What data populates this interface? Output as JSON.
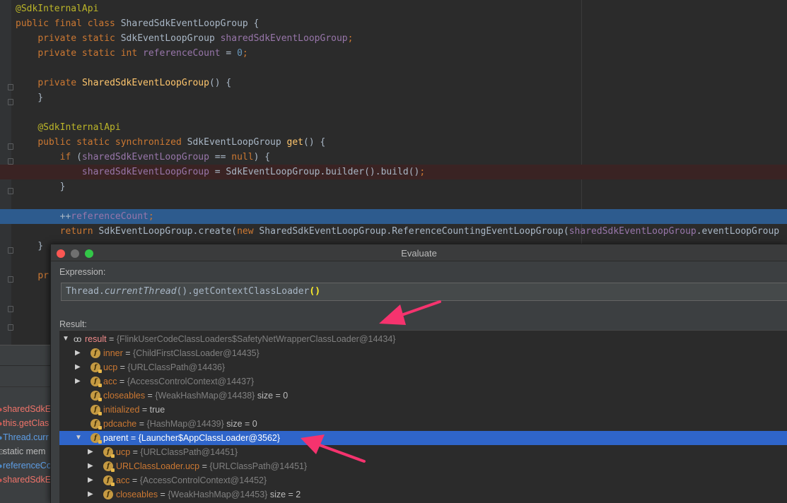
{
  "editor": {
    "lines": [
      {
        "type": "plain",
        "parts": [
          [
            "ann",
            "@SdkInternalApi"
          ]
        ]
      },
      {
        "type": "plain",
        "parts": [
          [
            "kw",
            "public final class "
          ],
          [
            "txt",
            "SharedSdkEventLoopGroup {"
          ]
        ]
      },
      {
        "type": "plain",
        "parts": [
          [
            "txt",
            "    "
          ],
          [
            "kw",
            "private static "
          ],
          [
            "txt",
            "SdkEventLoopGroup "
          ],
          [
            "fld",
            "sharedSdkEventLoopGroup"
          ],
          [
            "kw",
            ";"
          ]
        ]
      },
      {
        "type": "plain",
        "parts": [
          [
            "txt",
            "    "
          ],
          [
            "kw",
            "private static int "
          ],
          [
            "fld",
            "referenceCount"
          ],
          [
            "txt",
            " = "
          ],
          [
            "num",
            "0"
          ],
          [
            "kw",
            ";"
          ]
        ]
      },
      {
        "type": "plain",
        "parts": [
          [
            "txt",
            ""
          ]
        ]
      },
      {
        "type": "plain",
        "parts": [
          [
            "txt",
            "    "
          ],
          [
            "kw",
            "private "
          ],
          [
            "fn",
            "SharedSdkEventLoopGroup"
          ],
          [
            "txt",
            "() {"
          ]
        ]
      },
      {
        "type": "plain",
        "parts": [
          [
            "txt",
            "    }"
          ]
        ]
      },
      {
        "type": "plain",
        "parts": [
          [
            "txt",
            ""
          ]
        ]
      },
      {
        "type": "plain",
        "parts": [
          [
            "txt",
            "    "
          ],
          [
            "ann",
            "@SdkInternalApi"
          ]
        ]
      },
      {
        "type": "plain",
        "parts": [
          [
            "txt",
            "    "
          ],
          [
            "kw",
            "public static synchronized "
          ],
          [
            "txt",
            "SdkEventLoopGroup "
          ],
          [
            "fn",
            "get"
          ],
          [
            "txt",
            "() {"
          ]
        ]
      },
      {
        "type": "plain",
        "parts": [
          [
            "txt",
            "        "
          ],
          [
            "kw",
            "if "
          ],
          [
            "txt",
            "("
          ],
          [
            "fld",
            "sharedSdkEventLoopGroup"
          ],
          [
            "txt",
            " == "
          ],
          [
            "kw",
            "null"
          ],
          [
            "txt",
            ") {"
          ]
        ]
      },
      {
        "type": "breakpoint",
        "parts": [
          [
            "txt",
            "            "
          ],
          [
            "fld",
            "sharedSdkEventLoopGroup"
          ],
          [
            "txt",
            " = SdkEventLoopGroup."
          ],
          [
            "txt",
            "builder().build()"
          ],
          [
            "kw",
            ";"
          ]
        ]
      },
      {
        "type": "plain",
        "parts": [
          [
            "txt",
            "        }"
          ]
        ]
      },
      {
        "type": "plain",
        "parts": [
          [
            "txt",
            ""
          ]
        ]
      },
      {
        "type": "exec",
        "parts": [
          [
            "txt",
            "        ++"
          ],
          [
            "fld",
            "referenceCount"
          ],
          [
            "kw",
            ";"
          ]
        ]
      },
      {
        "type": "plain",
        "parts": [
          [
            "txt",
            "        "
          ],
          [
            "kw",
            "return "
          ],
          [
            "txt",
            "SdkEventLoopGroup."
          ],
          [
            "txt",
            "create("
          ],
          [
            "kw",
            "new "
          ],
          [
            "txt",
            "SharedSdkEventLoopGroup.ReferenceCountingEventLoopGroup("
          ],
          [
            "fld",
            "sharedSdkEventLoopGroup"
          ],
          [
            "txt",
            ".eventLoopGroup"
          ]
        ]
      },
      {
        "type": "plain",
        "parts": [
          [
            "txt",
            "    }"
          ]
        ]
      },
      {
        "type": "plain",
        "parts": [
          [
            "txt",
            ""
          ]
        ]
      },
      {
        "type": "plain",
        "parts": [
          [
            "txt",
            "    "
          ],
          [
            "kw",
            "pr"
          ]
        ]
      }
    ]
  },
  "watches": [
    {
      "icon": "red",
      "label": "sharedSdkE"
    },
    {
      "icon": "red",
      "label": "this.getClas"
    },
    {
      "icon": "blue",
      "label": "Thread.curr"
    },
    {
      "icon": "grey",
      "label": "static mem"
    },
    {
      "icon": "blue",
      "label": "referenceCo"
    },
    {
      "icon": "red",
      "label": "sharedSdkE"
    }
  ],
  "evaluate": {
    "title": "Evaluate",
    "expression_label": "Expression:",
    "expression_prefix": "Thread.",
    "expression_italic": "currentThread",
    "expression_mid": "().getContextClassLoader",
    "expression_paren": "()",
    "result_label": "Result:",
    "rows": [
      {
        "indent": 0,
        "arrow": "down",
        "icon": "oo",
        "name": "result",
        "eq": " = ",
        "value": "{FlinkUserCodeClassLoaders$SafetyNetWrapperClassLoader@14434}",
        "extra": "",
        "selected": false
      },
      {
        "indent": 1,
        "arrow": "right",
        "icon": "f",
        "name": "inner",
        "eq": " = ",
        "value": "{ChildFirstClassLoader@14435}",
        "extra": "",
        "selected": false
      },
      {
        "indent": 1,
        "arrow": "right",
        "icon": "flock",
        "name": "ucp",
        "eq": " = ",
        "value": "{URLClassPath@14436}",
        "extra": "",
        "selected": false
      },
      {
        "indent": 1,
        "arrow": "right",
        "icon": "flock",
        "name": "acc",
        "eq": " = ",
        "value": "{AccessControlContext@14437}",
        "extra": "",
        "selected": false
      },
      {
        "indent": 1,
        "arrow": "none",
        "icon": "flock",
        "name": "closeables",
        "eq": " = ",
        "value": "{WeakHashMap@14438}",
        "extra": "  size = 0",
        "selected": false
      },
      {
        "indent": 1,
        "arrow": "none",
        "icon": "flock",
        "name": "initialized",
        "eq": " = ",
        "value": "",
        "prim": "true",
        "extra": "",
        "selected": false
      },
      {
        "indent": 1,
        "arrow": "none",
        "icon": "flock",
        "name": "pdcache",
        "eq": " = ",
        "value": "{HashMap@14439}",
        "extra": "  size = 0",
        "selected": false
      },
      {
        "indent": 1,
        "arrow": "down",
        "icon": "flock",
        "name": "parent",
        "eq": " = ",
        "value": "{Launcher$AppClassLoader@3562}",
        "extra": "",
        "selected": true
      },
      {
        "indent": 2,
        "arrow": "right",
        "icon": "flock",
        "name": "ucp",
        "eq": " = ",
        "value": "{URLClassPath@14451}",
        "extra": "",
        "selected": false
      },
      {
        "indent": 2,
        "arrow": "right",
        "icon": "flock",
        "name": "URLClassLoader.ucp",
        "eq": " = ",
        "value": "{URLClassPath@14451}",
        "extra": "",
        "selected": false
      },
      {
        "indent": 2,
        "arrow": "right",
        "icon": "flock",
        "name": "acc",
        "eq": " = ",
        "value": "{AccessControlContext@14452}",
        "extra": "",
        "selected": false
      },
      {
        "indent": 2,
        "arrow": "right",
        "icon": "f",
        "name": "closeables",
        "eq": " = ",
        "value": "{WeakHashMap@14453}",
        "extra": "  size = 2",
        "selected": false
      }
    ]
  },
  "colors": {
    "annotation_arrow": "#f5336e",
    "selection": "#2f65ca",
    "exec_line": "#2d5b8e"
  }
}
